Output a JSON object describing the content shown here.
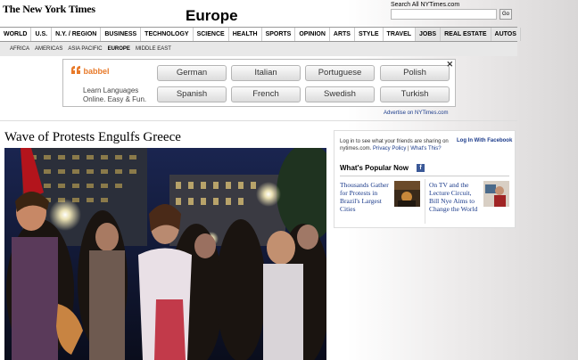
{
  "header": {
    "masthead": "The New York Times",
    "section": "Europe",
    "search_label": "Search All NYTimes.com",
    "search_value": "",
    "search_button": "Go"
  },
  "nav": {
    "items": [
      "WORLD",
      "U.S.",
      "N.Y. / REGION",
      "BUSINESS",
      "TECHNOLOGY",
      "SCIENCE",
      "HEALTH",
      "SPORTS",
      "OPINION",
      "ARTS",
      "STYLE",
      "TRAVEL",
      "JOBS",
      "REAL ESTATE",
      "AUTOS"
    ],
    "sub_items": [
      "AFRICA",
      "AMERICAS",
      "ASIA PACIFIC",
      "EUROPE",
      "MIDDLE EAST"
    ]
  },
  "ad": {
    "brand": "babbel",
    "tagline": "Learn Languages Online. Easy & Fun.",
    "buttons": [
      "German",
      "Italian",
      "Portuguese",
      "Polish",
      "Spanish",
      "French",
      "Swedish",
      "Turkish"
    ],
    "close": "✕",
    "advertise_link": "Advertise on NYTimes.com"
  },
  "article": {
    "headline": "Wave of Protests Engulfs Greece"
  },
  "sidebar": {
    "login_text": "Log in to see what your friends are sharing on nytimes.com.",
    "privacy_link": "Privacy Policy",
    "whats_this": "What's This?",
    "login_link": "Log In With Facebook",
    "popular_title": "What's Popular Now",
    "popular_items": [
      "Thousands Gather for Protests in Brazil's Largest Cities",
      "On TV and the Lecture Circuit, Bill Nye Aims to Change the World"
    ]
  },
  "colors": {
    "link": "#1a3a8a",
    "brand_orange": "#e87a2a",
    "facebook": "#3b5998"
  }
}
